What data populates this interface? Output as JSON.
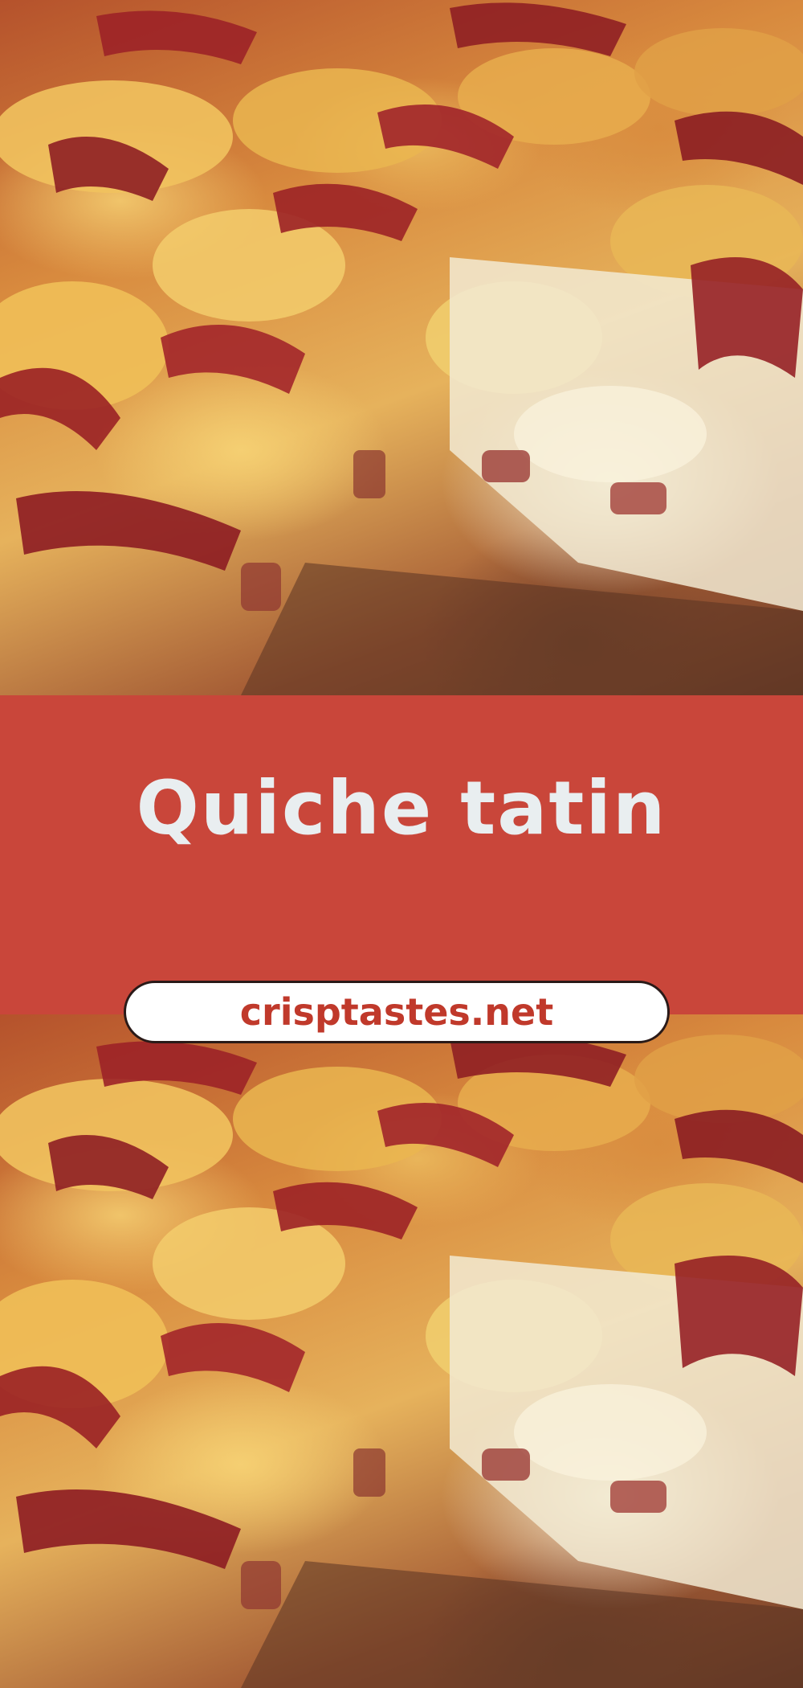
{
  "title": "Quiche tatin",
  "website": "crisptastes.net",
  "colors": {
    "band": "#c9463a",
    "title_text": "#e9eef0",
    "pill_bg": "#ffffff",
    "pill_text": "#c0392b"
  },
  "images": {
    "top": "quiche-tatin-photo",
    "bottom": "quiche-tatin-photo"
  }
}
